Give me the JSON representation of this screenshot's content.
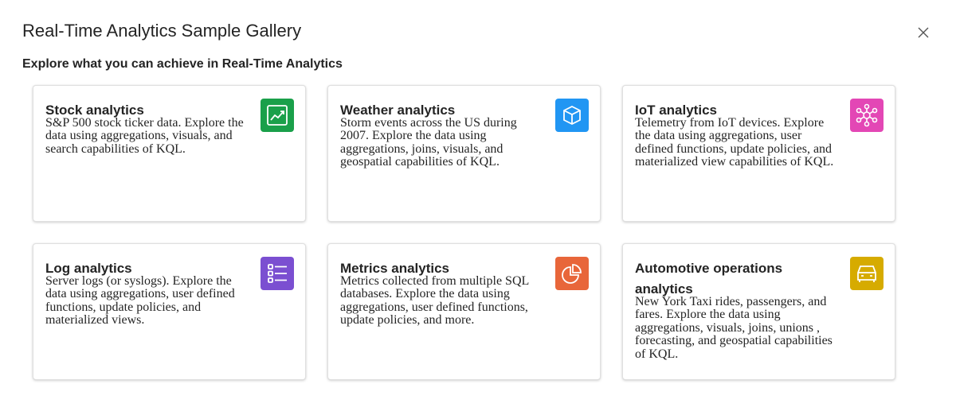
{
  "dialog": {
    "title": "Real-Time Analytics Sample Gallery",
    "subtitle": "Explore what you can achieve in Real-Time Analytics"
  },
  "cards": [
    {
      "title": "Stock analytics",
      "description": "S&P 500 stock ticker data. Explore the data using aggregations, visuals, and search capabilities of KQL.",
      "icon": "chart-trend-icon",
      "color": "#1aa04a"
    },
    {
      "title": "Weather analytics",
      "description": "Storm events across the US during 2007. Explore the data using aggregations, joins, visuals, and geospatial capabilities of KQL.",
      "icon": "cube-icon",
      "color": "#2196f3"
    },
    {
      "title": "IoT analytics",
      "description": "Telemetry from IoT devices. Explore the data using aggregations, user defined functions, update policies, and materialized view capabilities of KQL.",
      "icon": "network-icon",
      "color": "#e347b5"
    },
    {
      "title": "Log analytics",
      "description": "Server logs (or syslogs). Explore the data using aggregations, user defined functions, update policies, and materialized views.",
      "icon": "list-icon",
      "color": "#7b4fd1"
    },
    {
      "title": "Metrics analytics",
      "description": "Metrics collected from multiple SQL databases. Explore the data using aggregations, user defined functions, update policies, and more.",
      "icon": "pie-chart-icon",
      "color": "#e8663a"
    },
    {
      "title": "Automotive operations analytics",
      "description": "New York Taxi rides, passengers, and fares. Explore the data using aggregations, visuals, joins, unions , forecasting, and geospatial capabilities of KQL.",
      "icon": "car-icon",
      "color": "#d6ab00"
    }
  ]
}
